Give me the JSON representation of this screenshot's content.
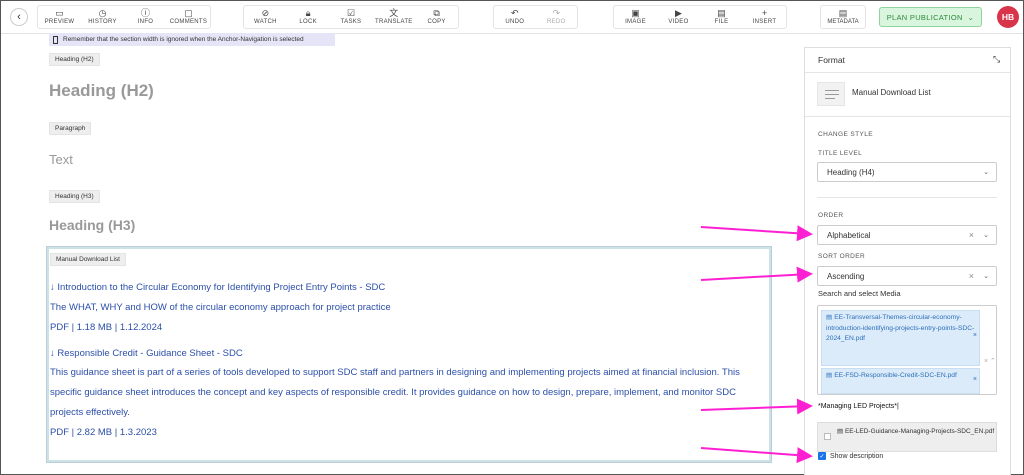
{
  "toolbar": {
    "groups": [
      [
        {
          "label": "PREVIEW",
          "icon": "▭"
        },
        {
          "label": "HISTORY",
          "icon": "◷"
        },
        {
          "label": "INFO",
          "icon": "ⓘ"
        },
        {
          "label": "COMMENTS",
          "icon": "▢"
        }
      ],
      [
        {
          "label": "WATCH",
          "icon": "⊘"
        },
        {
          "label": "LOCK",
          "icon": "🔒︎"
        },
        {
          "label": "TASKS",
          "icon": "☑"
        },
        {
          "label": "TRANSLATE",
          "icon": "文"
        },
        {
          "label": "COPY",
          "icon": "⧉"
        }
      ],
      [
        {
          "label": "UNDO",
          "icon": "↶"
        },
        {
          "label": "REDO",
          "icon": "↷",
          "disabled": true
        }
      ],
      [
        {
          "label": "IMAGE",
          "icon": "▣"
        },
        {
          "label": "VIDEO",
          "icon": "▶"
        },
        {
          "label": "FILE",
          "icon": "▤"
        },
        {
          "label": "INSERT",
          "icon": "+"
        }
      ]
    ],
    "metadata": {
      "label": "METADATA",
      "icon": "▤"
    },
    "publish_label": "PLAN PUBLICATION",
    "avatar_initials": "HB"
  },
  "main": {
    "notice": "Remember that the section width is ignored when the Anchor-Navigation is selected",
    "h2_tag": "Heading (H2)",
    "h2_text": "Heading (H2)",
    "para_tag": "Paragraph",
    "para_text": "Text",
    "h3_tag": "Heading (H3)",
    "h3_text": "Heading (H3)",
    "download_list": {
      "tag": "Manual Download List",
      "items": [
        {
          "title": "Introduction to the Circular Economy for Identifying Project Entry Points - SDC",
          "description_lines": [
            "The WHAT, WHY and HOW of the circular economy approach for project practice"
          ],
          "meta": "PDF  |  1.18 MB  |  1.12.2024"
        },
        {
          "title": "Responsible Credit - Guidance Sheet - SDC",
          "description_lines": [
            "This guidance sheet is part of a series of tools developed to support SDC staff and partners in designing and implementing projects aimed at financial inclusion. This",
            "specific guidance sheet introduces the concept and key aspects of responsible credit. It provides guidance on how to design, prepare, implement, and monitor SDC",
            "projects effectively."
          ],
          "meta": "PDF  |  2.82 MB  |  1.3.2023"
        }
      ]
    }
  },
  "panel": {
    "title": "Format",
    "component_name": "Manual Download List",
    "change_style_label": "CHANGE STYLE",
    "title_level_label": "TITLE LEVEL",
    "title_level_value": "Heading (H4)",
    "order_label": "ORDER",
    "order_value": "Alphabetical",
    "sort_order_label": "SORT ORDER",
    "sort_order_value": "Ascending",
    "media_label": "Search and select Media",
    "selected_media": [
      "EE-Transversal-Themes-circular-economy-introduction-identifying-projects-entry-points-SDC-2024_EN.pdf",
      "EE-FSD-Responsible-Credit-SDC-EN.pdf"
    ],
    "search_value": "*Managing LED Projects*",
    "dropdown_option": "EE-LED-Guidance-Managing-Projects-SDC_EN.pdf",
    "show_description_label": "Show description",
    "show_description_checked": true
  },
  "colors": {
    "accent_annotation": "#ff1fd2",
    "publish_bg": "#d9f5dd",
    "publish_text": "#2f8a3c",
    "avatar_bg": "#d8344a",
    "link_blue": "#2b4fa8",
    "chip_bg": "#dcebfa"
  }
}
